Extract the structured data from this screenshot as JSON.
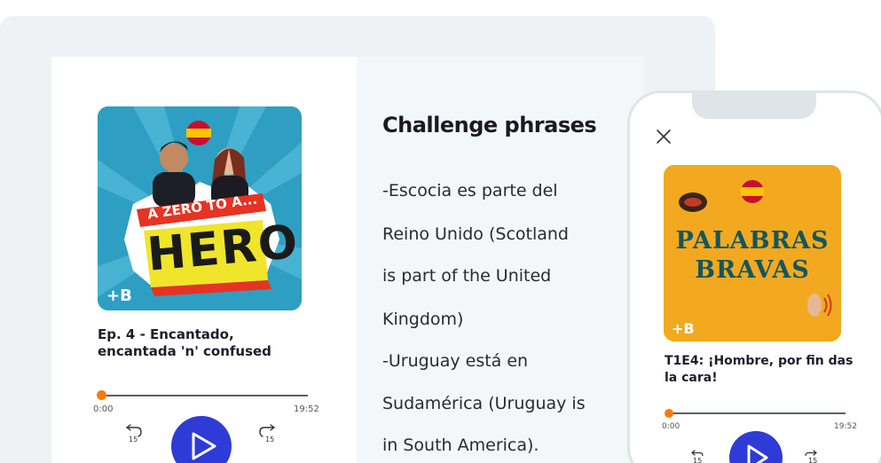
{
  "player": {
    "cover": {
      "title_top": "A ZERO TO A...",
      "title_main": "HERO",
      "brand": "+B"
    },
    "episode_title": "Ep. 4 - Encantado, encantada 'n' confused",
    "progress": 0.0,
    "time_start": "0:00",
    "time_end": "19:52",
    "skip_seconds": "15",
    "accent_color": "#2f3bd6",
    "progress_color": "#ff7a00"
  },
  "challenge": {
    "title": "Challenge phrases",
    "lines": [
      "-Escocia es parte del",
      "Reino Unido (Scotland",
      "is part of the United",
      "Kingdom)",
      "-Uruguay está en",
      "Sudamérica (Uruguay is",
      "in South America)."
    ]
  },
  "phone": {
    "cover": {
      "line1": "PALABRAS",
      "line2": "BRAVAS",
      "brand": "+B"
    },
    "episode_title": "T1E4: ¡Hombre, por fin das la cara!",
    "progress": 0.0,
    "time_start": "0:00",
    "time_end": "19:52",
    "skip_seconds": "15"
  }
}
